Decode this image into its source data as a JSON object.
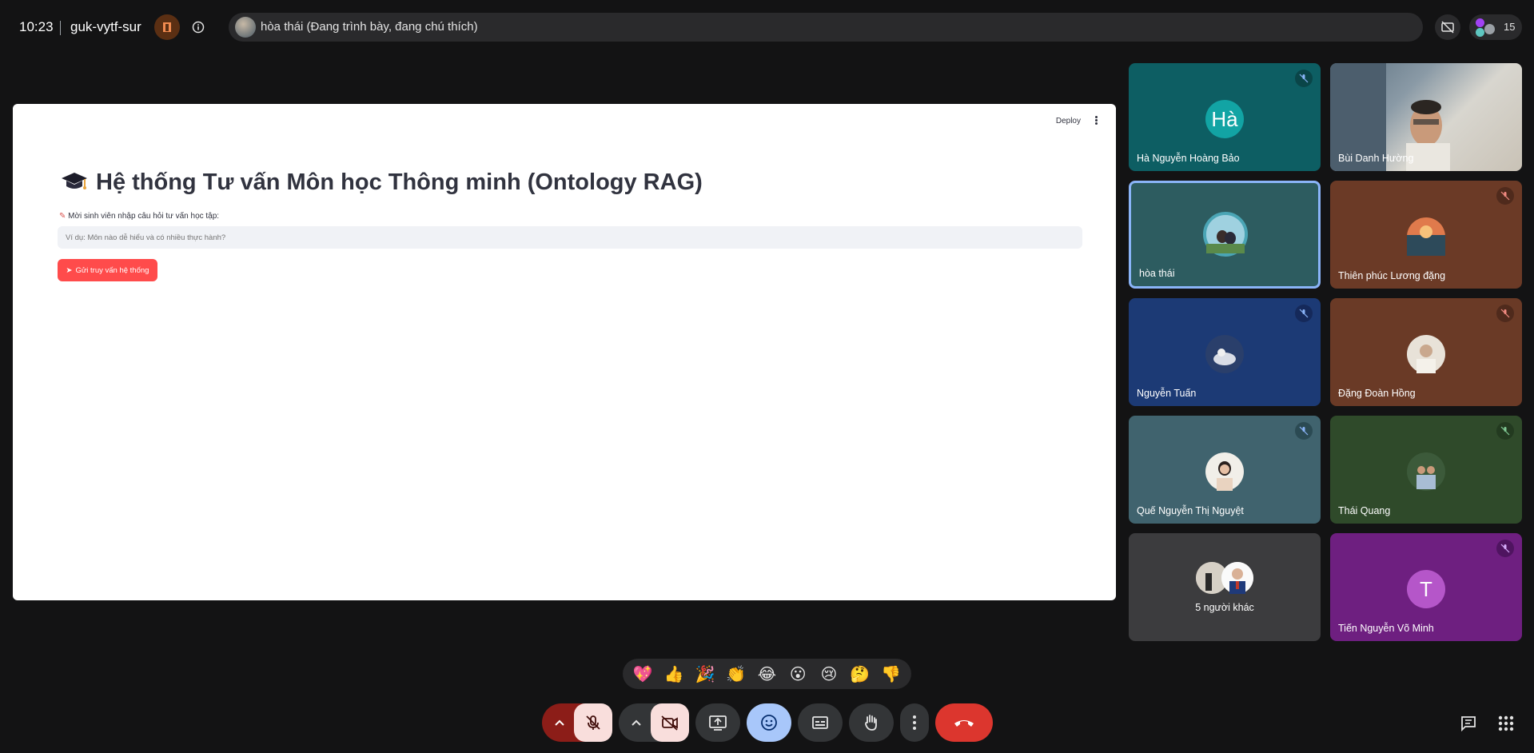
{
  "topbar": {
    "time": "10:23",
    "meeting_code": "guk-vytf-sur",
    "presenter_text": "hòa thái (Đang trình bày, đang chú thích)",
    "participant_count": "15"
  },
  "shared_screen": {
    "deploy_label": "Deploy",
    "title": "Hệ thống Tư vấn Môn học Thông minh (Ontology RAG)",
    "prompt_label": "Mời sinh viên nhập câu hỏi tư vấn học tập:",
    "input_placeholder": "Ví dụ: Môn nào dễ hiểu và có nhiều thực hành?",
    "submit_label": "Gửi truy vấn hệ thống"
  },
  "tiles": [
    {
      "name": "Hà Nguyễn Hoàng Bảo",
      "initials": "Hà",
      "muted": true,
      "color": "#0d5e63"
    },
    {
      "name": "Bùi Danh Hường",
      "video": true,
      "muted": false
    },
    {
      "name": "hòa thái",
      "muted": false,
      "speaking": true,
      "color": "#2d5c60"
    },
    {
      "name": "Thiên phúc Lương đặng",
      "muted": true,
      "color": "#6b3a26"
    },
    {
      "name": "Nguyễn Tuấn",
      "muted": true,
      "color": "#1c3a75"
    },
    {
      "name": "Đặng Đoàn Hồng",
      "muted": true,
      "color": "#6a3a26"
    },
    {
      "name": "Quế Nguyễn Thị Nguyệt",
      "muted": true,
      "color": "#40636e"
    },
    {
      "name": "Thái Quang",
      "muted": true,
      "color": "#2f4a2a"
    },
    {
      "name": "5 người khác",
      "color": "#3c3c3e"
    },
    {
      "name": "Tiến Nguyễn Võ Minh",
      "initials": "T",
      "muted": true,
      "color": "#6e1f80"
    }
  ],
  "reactions": [
    "💖",
    "👍",
    "🎉",
    "👏",
    "😂",
    "😮",
    "😢",
    "🤔",
    "👎"
  ],
  "colors": {
    "background": "#131314",
    "end_call": "#dc362e",
    "mic_off_bg": "#f9dedc",
    "emoji_active": "#a8c7fa",
    "streamlit_red": "#ff4b4b"
  }
}
